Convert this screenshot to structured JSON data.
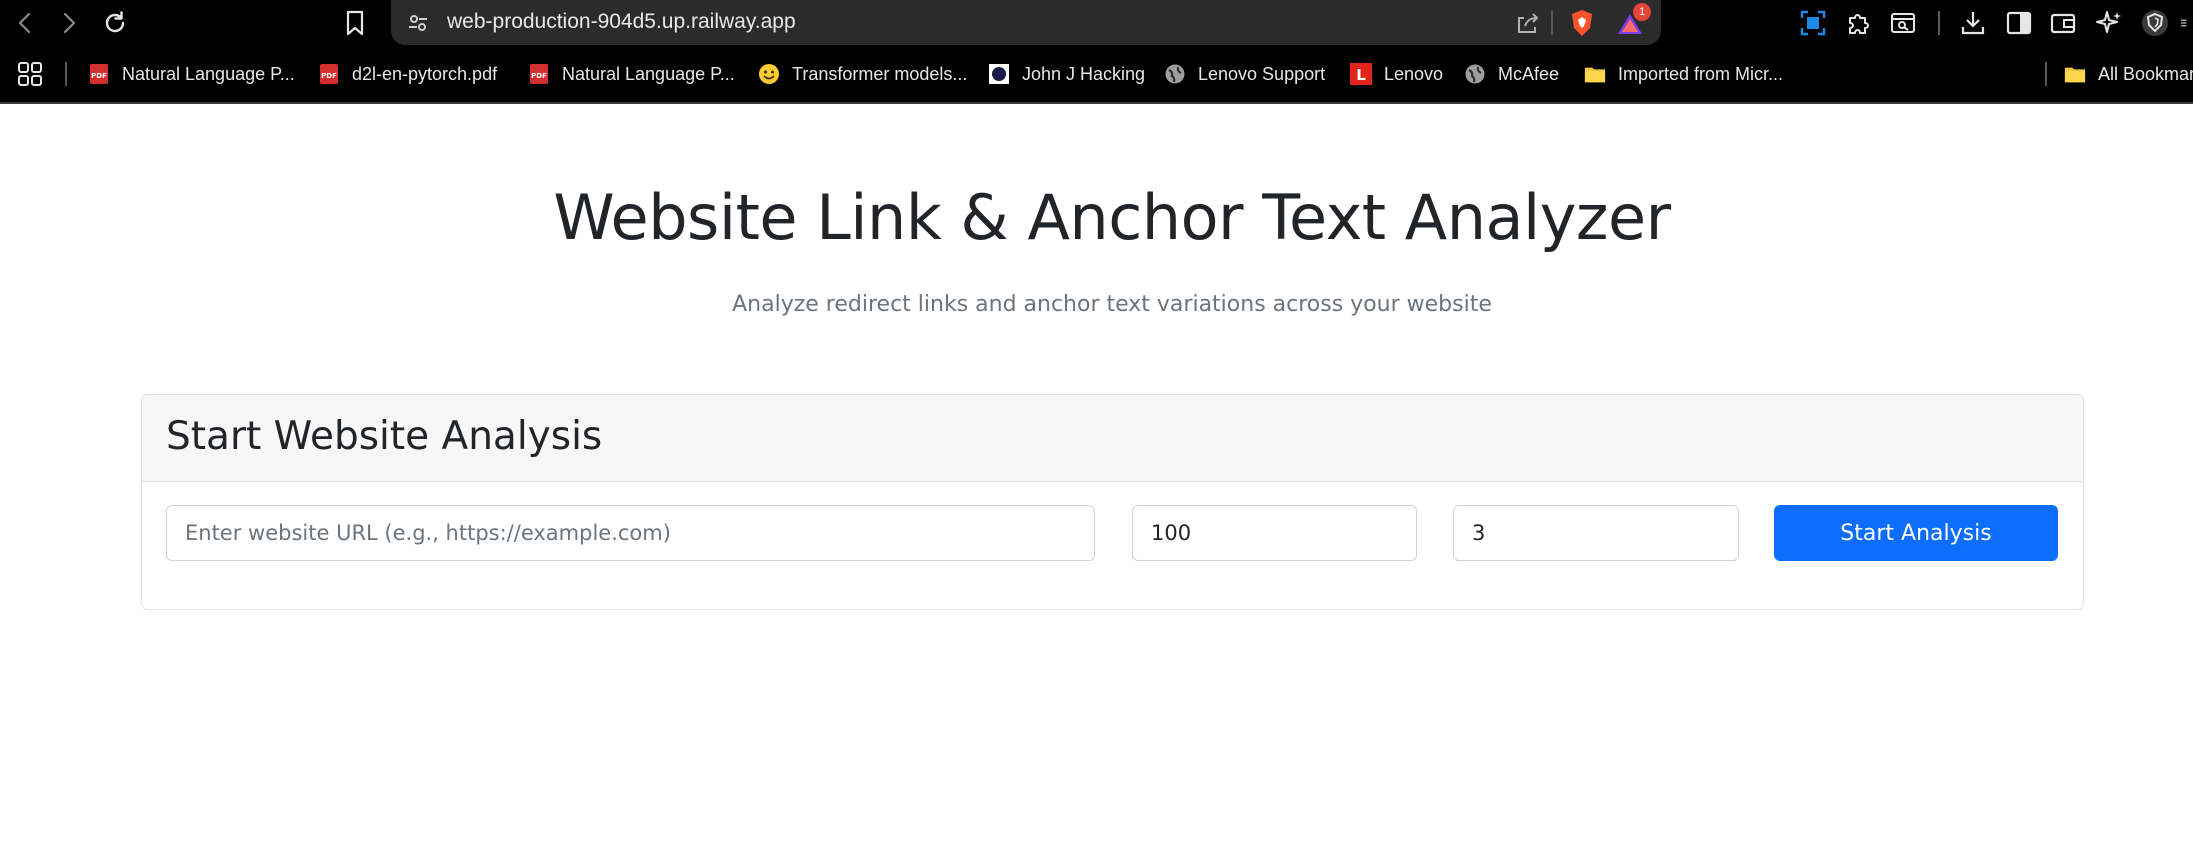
{
  "browser": {
    "url": "web-production-904d5.up.railway.app",
    "notification_count": "1",
    "bookmarks": [
      {
        "label": "Natural Language P...",
        "icon": "pdf-icon"
      },
      {
        "label": "d2l-en-pytorch.pdf",
        "icon": "pdf-icon"
      },
      {
        "label": "Natural Language P...",
        "icon": "pdf-icon"
      },
      {
        "label": "Transformer models...",
        "icon": "hugging-face-icon"
      },
      {
        "label": "John J Hacking",
        "icon": "site-icon"
      },
      {
        "label": "Lenovo Support",
        "icon": "globe-icon"
      },
      {
        "label": "Lenovo",
        "icon": "lenovo-icon"
      },
      {
        "label": "McAfee",
        "icon": "globe-icon"
      },
      {
        "label": "Imported from Micr...",
        "icon": "folder-icon"
      }
    ],
    "all_bookmarks_label": "All Bookmar"
  },
  "page": {
    "title": "Website Link & Anchor Text Analyzer",
    "subtitle": "Analyze redirect links and anchor text variations across your website"
  },
  "form": {
    "card_title": "Start Website Analysis",
    "url_placeholder": "Enter website URL (e.g., https://example.com)",
    "url_value": "",
    "max_pages_value": "100",
    "depth_value": "3",
    "submit_label": "Start Analysis"
  },
  "colors": {
    "primary": "#0d6efd",
    "text": "#212529",
    "muted": "#6c757d",
    "card_header_bg": "#f7f7f7"
  }
}
